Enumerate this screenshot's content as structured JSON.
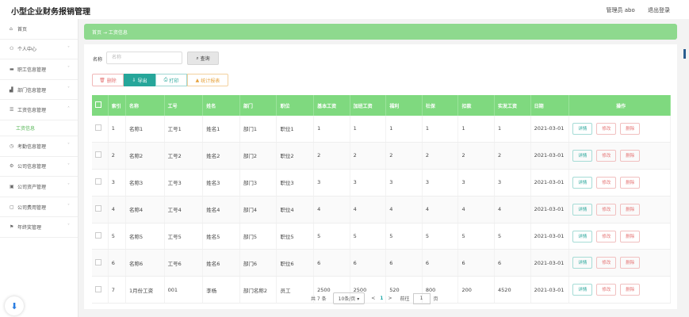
{
  "header": {
    "app_title": "小型企业财务报销管理",
    "user_label": "管理员 abo",
    "logout_label": "退出登录"
  },
  "sidebar": {
    "items": [
      {
        "label": "首页",
        "icon": "home-icon",
        "glyph": "⌂",
        "chevron": false
      },
      {
        "label": "个人中心",
        "icon": "user-icon",
        "glyph": "⚇",
        "chevron": true
      },
      {
        "label": "职工信息管理",
        "icon": "card-icon",
        "glyph": "▬",
        "chevron": true
      },
      {
        "label": "部门信息管理",
        "icon": "chart-icon",
        "glyph": "▟",
        "chevron": true
      },
      {
        "label": "工资信息管理",
        "icon": "list-icon",
        "glyph": "☰",
        "chevron": true,
        "expanded": true
      }
    ],
    "sub_item": "工资信息",
    "items_after": [
      {
        "label": "考勤信息管理",
        "icon": "clock-icon",
        "glyph": "◷",
        "chevron": true
      },
      {
        "label": "公司信息管理",
        "icon": "gear-icon",
        "glyph": "⚙",
        "chevron": true
      },
      {
        "label": "公司资产管理",
        "icon": "briefcase-icon",
        "glyph": "▣",
        "chevron": true
      },
      {
        "label": "公司费用管理",
        "icon": "money-icon",
        "glyph": "▢",
        "chevron": true
      },
      {
        "label": "年终奖管理",
        "icon": "flag-icon",
        "glyph": "⚑",
        "chevron": true
      }
    ]
  },
  "breadcrumb": {
    "home": "首页",
    "arrow": "→",
    "current": "工资信息"
  },
  "search": {
    "label": "名称",
    "placeholder": "名称",
    "button": "查询"
  },
  "actions": {
    "delete": "删除",
    "export": "导出",
    "print": "打印",
    "stats": "统计报表"
  },
  "table": {
    "columns": [
      "索引",
      "名称",
      "工号",
      "姓名",
      "部门",
      "职位",
      "基本工资",
      "加班工资",
      "福利",
      "社保",
      "扣款",
      "实发工资",
      "日期",
      "操作"
    ],
    "rows": [
      [
        "1",
        "名称1",
        "工号1",
        "姓名1",
        "部门1",
        "职位1",
        "1",
        "1",
        "1",
        "1",
        "1",
        "1",
        "2021-03-01"
      ],
      [
        "2",
        "名称2",
        "工号2",
        "姓名2",
        "部门2",
        "职位2",
        "2",
        "2",
        "2",
        "2",
        "2",
        "2",
        "2021-03-01"
      ],
      [
        "3",
        "名称3",
        "工号3",
        "姓名3",
        "部门3",
        "职位3",
        "3",
        "3",
        "3",
        "3",
        "3",
        "3",
        "2021-03-01"
      ],
      [
        "4",
        "名称4",
        "工号4",
        "姓名4",
        "部门4",
        "职位4",
        "4",
        "4",
        "4",
        "4",
        "4",
        "4",
        "2021-03-01"
      ],
      [
        "5",
        "名称5",
        "工号5",
        "姓名5",
        "部门5",
        "职位5",
        "5",
        "5",
        "5",
        "5",
        "5",
        "5",
        "2021-03-01"
      ],
      [
        "6",
        "名称6",
        "工号6",
        "姓名6",
        "部门6",
        "职位6",
        "6",
        "6",
        "6",
        "6",
        "6",
        "6",
        "2021-03-01"
      ],
      [
        "7",
        "1月份工资",
        "001",
        "李杨",
        "部门名称2",
        "员工",
        "2500",
        "2500",
        "520",
        "800",
        "200",
        "4520",
        "2021-03-01"
      ]
    ],
    "row_actions": {
      "view": "详情",
      "edit": "修改",
      "delete": "删除"
    }
  },
  "pagination": {
    "total": "共 7 条",
    "page_size": "10条/页",
    "prev": "<",
    "current": "1",
    "next": ">",
    "goto_label": "前往",
    "goto_value": "1",
    "page_unit": "页"
  }
}
